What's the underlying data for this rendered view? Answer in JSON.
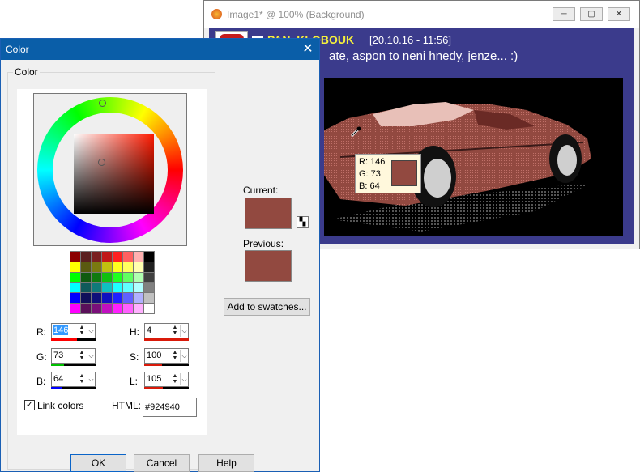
{
  "image_window": {
    "title": "Image1* @ 100% (Background)",
    "controls": {
      "minimize": "─",
      "maximize": "▢",
      "close": "✕"
    },
    "chat": {
      "name": "PAN_KLOBOUK",
      "timestamp": "[20.10.16 - 11:56]",
      "message": "ate, aspon to neni hnedy, jenze... :)"
    },
    "tooltip": {
      "r": "R: 146",
      "g": "G: 73",
      "b": "B: 64"
    }
  },
  "color_dialog": {
    "title": "Color",
    "close": "✕",
    "group_label": "Color",
    "current_label": "Current:",
    "previous_label": "Previous:",
    "add_to_swatches": "Add to swatches...",
    "current_color": "#924940",
    "previous_color": "#924940",
    "swatches": [
      "#8b0000",
      "#5a1f1f",
      "#7a2020",
      "#c01818",
      "#ff2020",
      "#ff6060",
      "#ffb0b0",
      "#000000",
      "#ffff00",
      "#5a5a10",
      "#7a7a10",
      "#c0c010",
      "#ffff20",
      "#ffff60",
      "#ffffb0",
      "#202020",
      "#00ff00",
      "#105a10",
      "#107a10",
      "#10c010",
      "#20ff20",
      "#60ff60",
      "#b0ffb0",
      "#404040",
      "#00ffff",
      "#105a5a",
      "#107a7a",
      "#10c0c0",
      "#20ffff",
      "#60ffff",
      "#b0ffff",
      "#808080",
      "#0000ff",
      "#10105a",
      "#10107a",
      "#1010c0",
      "#2020ff",
      "#6060ff",
      "#b0b0ff",
      "#c0c0c0",
      "#ff00ff",
      "#5a105a",
      "#7a107a",
      "#c010c0",
      "#ff20ff",
      "#ff60ff",
      "#ffb0ff",
      "#ffffff"
    ],
    "fields": {
      "r": {
        "label": "R:",
        "value": "146",
        "level": 0.573
      },
      "g": {
        "label": "G:",
        "value": "73",
        "level": 0.286
      },
      "b": {
        "label": "B:",
        "value": "64",
        "level": 0.251
      },
      "h": {
        "label": "H:",
        "value": "4",
        "level": 0.011
      },
      "s": {
        "label": "S:",
        "value": "100",
        "level": 0.392
      },
      "l": {
        "label": "L:",
        "value": "105",
        "level": 0.412
      }
    },
    "link_colors": {
      "label": "Link colors",
      "checked": true,
      "mark": "✓"
    },
    "html": {
      "label": "HTML:",
      "value": "#924940"
    },
    "buttons": {
      "ok": "OK",
      "cancel": "Cancel",
      "help": "Help"
    }
  }
}
